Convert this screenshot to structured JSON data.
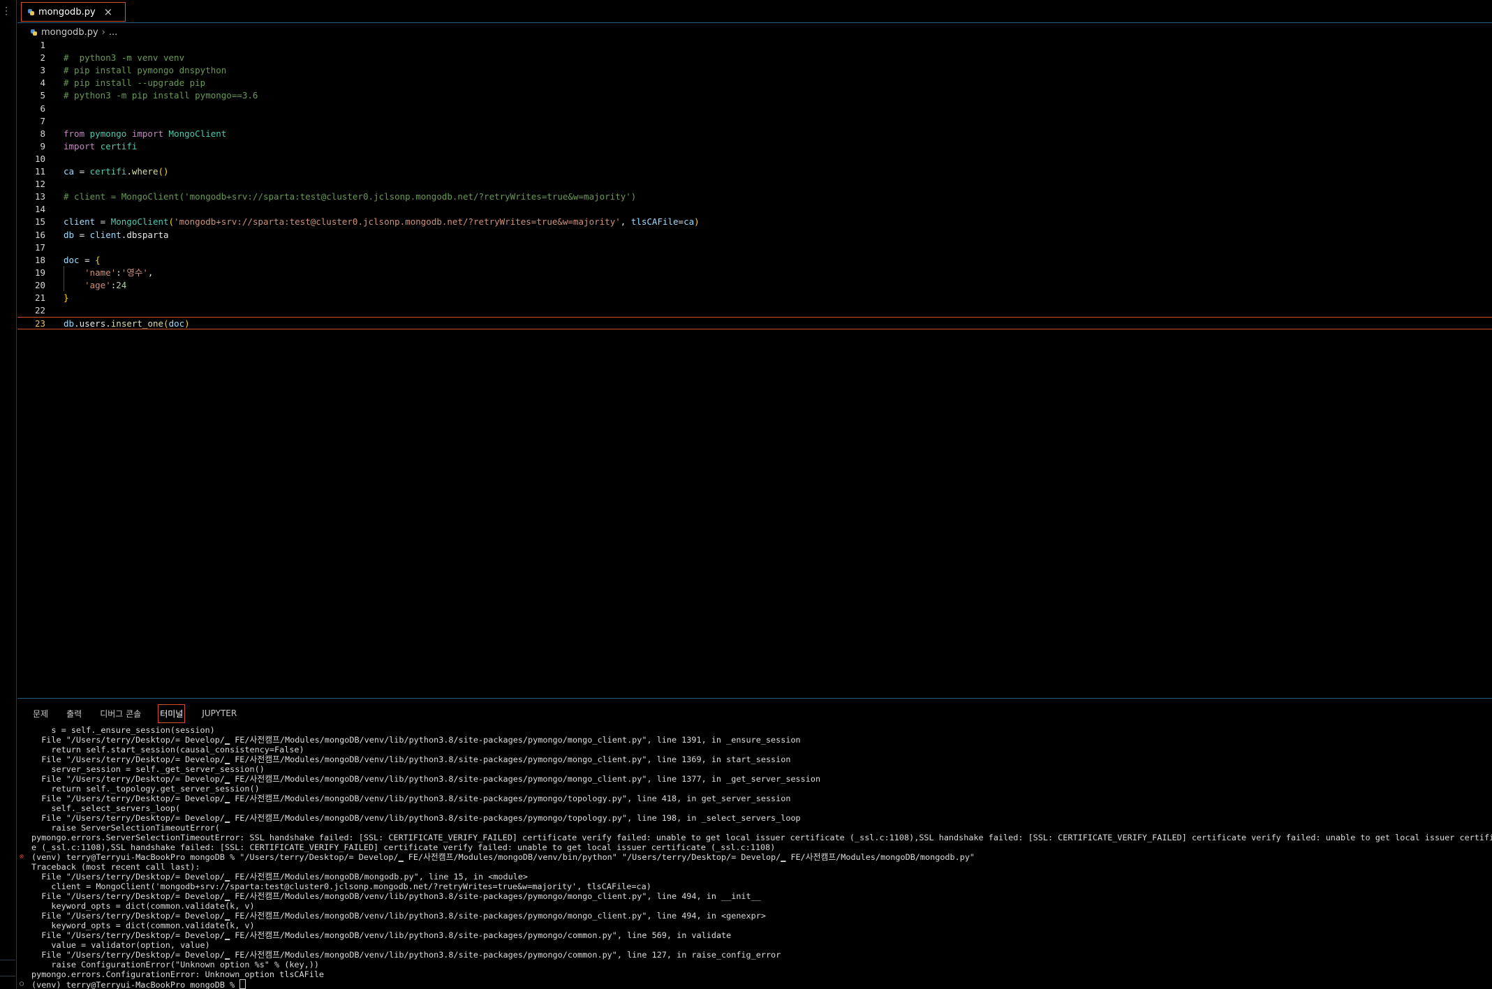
{
  "tab": {
    "filename": "mongodb.py",
    "close_glyph": "×"
  },
  "breadcrumb": {
    "file": "mongodb.py",
    "sep": "›",
    "ellipsis": "..."
  },
  "editor": {
    "line_numbers": [
      "1",
      "2",
      "3",
      "4",
      "5",
      "6",
      "7",
      "8",
      "9",
      "10",
      "11",
      "12",
      "13",
      "14",
      "15",
      "16",
      "17",
      "18",
      "19",
      "20",
      "21",
      "22",
      "23"
    ],
    "active_line": 23,
    "lines": [
      [],
      [
        [
          "c-com",
          "#  python3 -m venv venv"
        ]
      ],
      [
        [
          "c-com",
          "# pip install pymongo dnspython"
        ]
      ],
      [
        [
          "c-com",
          "# pip install --upgrade pip"
        ]
      ],
      [
        [
          "c-com",
          "# python3 -m pip install pymongo==3.6"
        ]
      ],
      [],
      [],
      [
        [
          "c-kw",
          "from"
        ],
        [
          "c-def",
          " "
        ],
        [
          "c-mod",
          "pymongo"
        ],
        [
          "c-def",
          " "
        ],
        [
          "c-kw",
          "import"
        ],
        [
          "c-def",
          " "
        ],
        [
          "c-cls",
          "MongoClient"
        ]
      ],
      [
        [
          "c-kw",
          "import"
        ],
        [
          "c-def",
          " "
        ],
        [
          "c-mod",
          "certifi"
        ]
      ],
      [],
      [
        [
          "c-var",
          "ca"
        ],
        [
          "c-def",
          " = "
        ],
        [
          "c-mod",
          "certifi"
        ],
        [
          "c-def",
          "."
        ],
        [
          "c-fn",
          "where"
        ],
        [
          "c-br",
          "()"
        ]
      ],
      [],
      [
        [
          "c-com",
          "# client = MongoClient('mongodb+srv://sparta:test@cluster0.jclsonp.mongodb.net/?retryWrites=true&w=majority')"
        ]
      ],
      [],
      [
        [
          "c-var",
          "client"
        ],
        [
          "c-def",
          " = "
        ],
        [
          "c-cls",
          "MongoClient"
        ],
        [
          "c-br",
          "("
        ],
        [
          "c-str",
          "'mongodb+srv://sparta:test@cluster0.jclsonp.mongodb.net/?retryWrites=true&w=majority'"
        ],
        [
          "c-def",
          ", "
        ],
        [
          "c-par",
          "tlsCAFile"
        ],
        [
          "c-def",
          "="
        ],
        [
          "c-var",
          "ca"
        ],
        [
          "c-br",
          ")"
        ]
      ],
      [
        [
          "c-var",
          "db"
        ],
        [
          "c-def",
          " = "
        ],
        [
          "c-var",
          "client"
        ],
        [
          "c-def",
          "."
        ],
        [
          "c-def",
          "dbsparta"
        ]
      ],
      [],
      [
        [
          "c-var",
          "doc"
        ],
        [
          "c-def",
          " = "
        ],
        [
          "c-br",
          "{"
        ]
      ],
      [
        [
          "c-def",
          "    "
        ],
        [
          "c-str",
          "'name'"
        ],
        [
          "c-def",
          ":"
        ],
        [
          "c-str",
          "'영수'"
        ],
        [
          "c-def",
          ","
        ]
      ],
      [
        [
          "c-def",
          "    "
        ],
        [
          "c-str",
          "'age'"
        ],
        [
          "c-def",
          ":"
        ],
        [
          "c-num",
          "24"
        ]
      ],
      [
        [
          "c-br",
          "}"
        ]
      ],
      [],
      [
        [
          "c-var",
          "db"
        ],
        [
          "c-def",
          "."
        ],
        [
          "c-def",
          "users"
        ],
        [
          "c-def",
          "."
        ],
        [
          "c-fn",
          "insert_one"
        ],
        [
          "c-br",
          "("
        ],
        [
          "c-var",
          "doc"
        ],
        [
          "c-br",
          ")"
        ]
      ]
    ]
  },
  "panel": {
    "tabs": [
      "문제",
      "출력",
      "디버그 콘솔",
      "터미널",
      "JUPYTER"
    ],
    "active_tab": "터미널"
  },
  "terminal": {
    "lines": [
      {
        "m": "",
        "t": "    s = self._ensure_session(session)"
      },
      {
        "m": "",
        "t": "  File \"/Users/terry/Desktop/= Develop/▁ FE/사전캠프/Modules/mongoDB/venv/lib/python3.8/site-packages/pymongo/mongo_client.py\", line 1391, in _ensure_session"
      },
      {
        "m": "",
        "t": "    return self.start_session(causal_consistency=False)"
      },
      {
        "m": "",
        "t": "  File \"/Users/terry/Desktop/= Develop/▁ FE/사전캠프/Modules/mongoDB/venv/lib/python3.8/site-packages/pymongo/mongo_client.py\", line 1369, in start_session"
      },
      {
        "m": "",
        "t": "    server_session = self._get_server_session()"
      },
      {
        "m": "",
        "t": "  File \"/Users/terry/Desktop/= Develop/▁ FE/사전캠프/Modules/mongoDB/venv/lib/python3.8/site-packages/pymongo/mongo_client.py\", line 1377, in _get_server_session"
      },
      {
        "m": "",
        "t": "    return self._topology.get_server_session()"
      },
      {
        "m": "",
        "t": "  File \"/Users/terry/Desktop/= Develop/▁ FE/사전캠프/Modules/mongoDB/venv/lib/python3.8/site-packages/pymongo/topology.py\", line 418, in get_server_session"
      },
      {
        "m": "",
        "t": "    self._select_servers_loop("
      },
      {
        "m": "",
        "t": "  File \"/Users/terry/Desktop/= Develop/▁ FE/사전캠프/Modules/mongoDB/venv/lib/python3.8/site-packages/pymongo/topology.py\", line 198, in _select_servers_loop"
      },
      {
        "m": "",
        "t": "    raise ServerSelectionTimeoutError("
      },
      {
        "m": "",
        "t": "pymongo.errors.ServerSelectionTimeoutError: SSL handshake failed: [SSL: CERTIFICATE_VERIFY_FAILED] certificate verify failed: unable to get local issuer certificate (_ssl.c:1108),SSL handshake failed: [SSL: CERTIFICATE_VERIFY_FAILED] certificate verify failed: unable to get local issuer certificat"
      },
      {
        "m": "",
        "t": "e (_ssl.c:1108),SSL handshake failed: [SSL: CERTIFICATE_VERIFY_FAILED] certificate verify failed: unable to get local issuer certificate (_ssl.c:1108)"
      },
      {
        "m": "err",
        "t": "(venv) terry@Terryui-MacBookPro mongoDB % \"/Users/terry/Desktop/= Develop/▁ FE/사전캠프/Modules/mongoDB/venv/bin/python\" \"/Users/terry/Desktop/= Develop/▁ FE/사전캠프/Modules/mongoDB/mongodb.py\""
      },
      {
        "m": "",
        "t": "Traceback (most recent call last):"
      },
      {
        "m": "",
        "t": "  File \"/Users/terry/Desktop/= Develop/▁ FE/사전캠프/Modules/mongoDB/mongodb.py\", line 15, in <module>"
      },
      {
        "m": "",
        "t": "    client = MongoClient('mongodb+srv://sparta:test@cluster0.jclsonp.mongodb.net/?retryWrites=true&w=majority', tlsCAFile=ca)"
      },
      {
        "m": "",
        "t": "  File \"/Users/terry/Desktop/= Develop/▁ FE/사전캠프/Modules/mongoDB/venv/lib/python3.8/site-packages/pymongo/mongo_client.py\", line 494, in __init__"
      },
      {
        "m": "",
        "t": "    keyword_opts = dict(common.validate(k, v)"
      },
      {
        "m": "",
        "t": "  File \"/Users/terry/Desktop/= Develop/▁ FE/사전캠프/Modules/mongoDB/venv/lib/python3.8/site-packages/pymongo/mongo_client.py\", line 494, in <genexpr>"
      },
      {
        "m": "",
        "t": "    keyword_opts = dict(common.validate(k, v)"
      },
      {
        "m": "",
        "t": "  File \"/Users/terry/Desktop/= Develop/▁ FE/사전캠프/Modules/mongoDB/venv/lib/python3.8/site-packages/pymongo/common.py\", line 569, in validate"
      },
      {
        "m": "",
        "t": "    value = validator(option, value)"
      },
      {
        "m": "",
        "t": "  File \"/Users/terry/Desktop/= Develop/▁ FE/사전캠프/Modules/mongoDB/venv/lib/python3.8/site-packages/pymongo/common.py\", line 127, in raise_config_error"
      },
      {
        "m": "",
        "t": "    raise ConfigurationError(\"Unknown option %s\" % (key,))"
      },
      {
        "m": "",
        "t": "pymongo.errors.ConfigurationError: Unknown option tlsCAFile"
      },
      {
        "m": "idle",
        "t": "(venv) terry@Terryui-MacBookPro mongoDB % ",
        "cursor": true
      }
    ]
  },
  "markers": {
    "err": "⊗",
    "idle": "○"
  },
  "gutter_glyph": "⋮"
}
